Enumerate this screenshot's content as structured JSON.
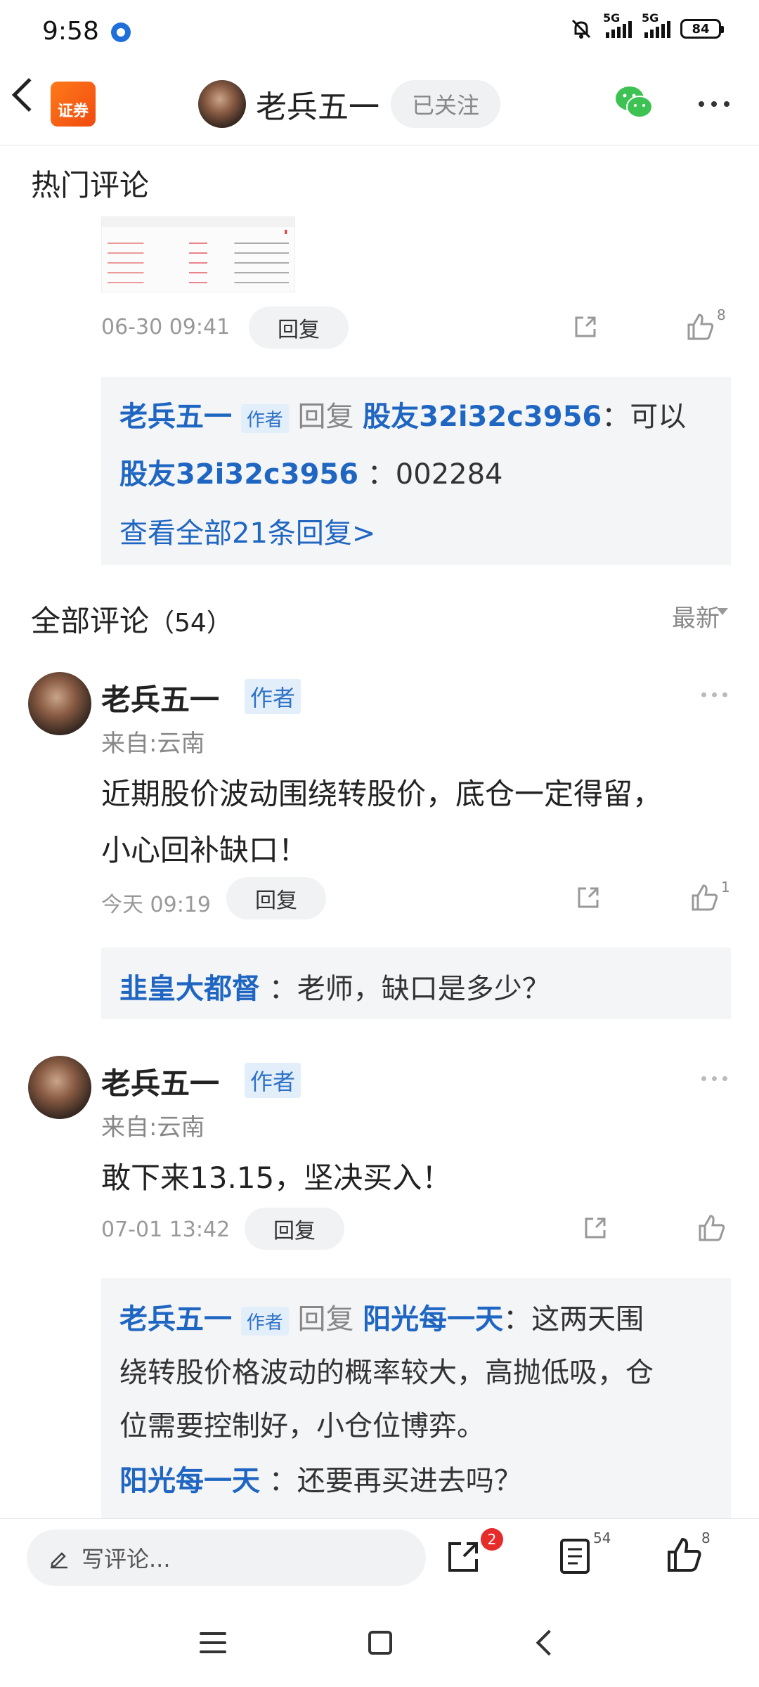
{
  "status_bar": {
    "time": "9:58",
    "network_1": "5G",
    "network_2": "5G",
    "battery": "84"
  },
  "header": {
    "app_logo_text": "证券",
    "author_name": "老兵五一",
    "follow_label": "已关注"
  },
  "hot_comments": {
    "title": "热门评论",
    "post": {
      "time": "06-30 09:41",
      "reply_label": "回复",
      "like_count": "8"
    },
    "reply_box": {
      "line1_name": "老兵五一",
      "author_tag": "作者",
      "reply_word": "回复",
      "line1_target": "股友32i32c3956",
      "line1_text": "：可以",
      "line2_name": "股友32i32c3956",
      "line2_text": "：002284",
      "view_all": "查看全部21条回复>"
    }
  },
  "all_comments": {
    "title": "全部评论",
    "count": "（54）",
    "sort_label": "最新",
    "items": [
      {
        "name": "老兵五一",
        "author_tag": "作者",
        "from": "来自:云南",
        "body_line1": "近期股价波动围绕转股价，底仓一定得留，",
        "body_line2": "小心回补缺口！",
        "time": "今天 09:19",
        "reply_label": "回复",
        "like_count": "1",
        "replies": [
          {
            "name": "韭皇大都督",
            "text": "：老师，缺口是多少？"
          }
        ]
      },
      {
        "name": "老兵五一",
        "author_tag": "作者",
        "from": "来自:云南",
        "body_line1": "敢下来13.15，坚决买入！",
        "time": "07-01 13:42",
        "reply_label": "回复",
        "reply_name": "老兵五一",
        "reply_author_tag": "作者",
        "reply_word": "回复",
        "reply_target": "阳光每一天",
        "reply_line1": "：这两天围",
        "reply_line2": "绕转股价格波动的概率较大，高抛低吸，仓",
        "reply_line3": "位需要控制好，小仓位博弈。",
        "sub_name": "阳光每一天",
        "sub_text": "：还要再买进去吗？"
      }
    ]
  },
  "bottom_bar": {
    "write_placeholder": "写评论...",
    "share_badge": "2",
    "comment_count": "54",
    "like_count": "8"
  }
}
